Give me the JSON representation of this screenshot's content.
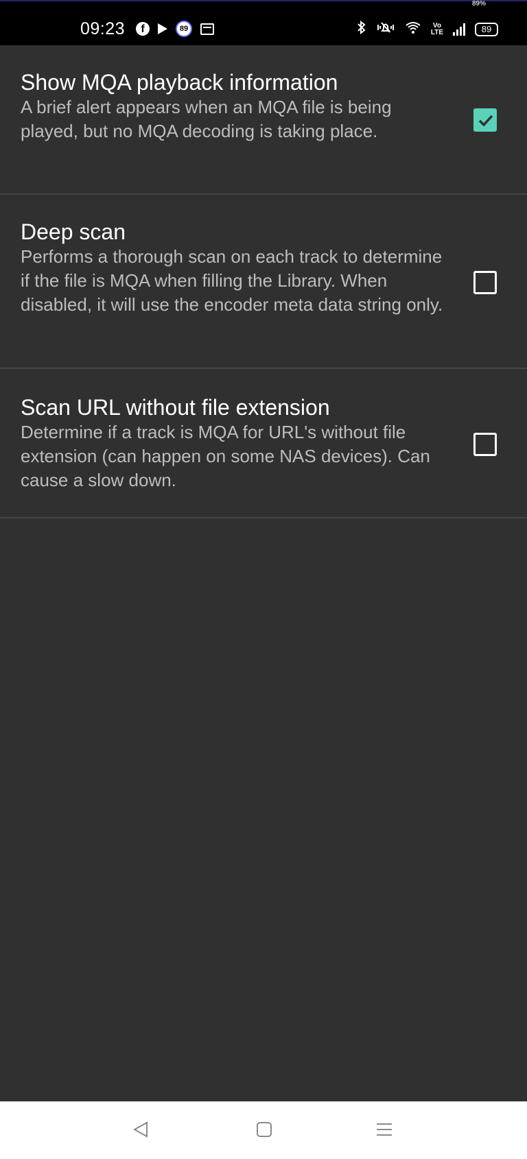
{
  "status_bar": {
    "time": "09:23",
    "top_percent": "89%",
    "notification_badge": "89",
    "lte_top": "Vo",
    "lte_bottom": "LTE",
    "battery": "89"
  },
  "preferences": [
    {
      "title": "Show MQA playback information",
      "summary": "A brief alert appears when an MQA file is being played, but no MQA decoding is taking place.",
      "checked": true
    },
    {
      "title": "Deep scan",
      "summary": "Performs a thorough scan on each track to determine if the file is MQA when filling the Library. When disabled, it will use the encoder meta data string only.",
      "checked": false
    },
    {
      "title": "Scan URL without file extension",
      "summary": "Determine if a track is MQA for URL's without file extension (can happen on some NAS devices). Can cause a slow down.",
      "checked": false
    }
  ],
  "colors": {
    "background": "#303030",
    "accent": "#5ad1b9",
    "divider": "#454545"
  },
  "icons": {
    "facebook": "facebook-icon",
    "play": "play-icon",
    "bluetooth": "bluetooth-icon",
    "vibrate": "vibrate-icon",
    "wifi": "wifi-icon",
    "back": "back-icon",
    "home": "home-icon",
    "recents": "recents-icon"
  }
}
